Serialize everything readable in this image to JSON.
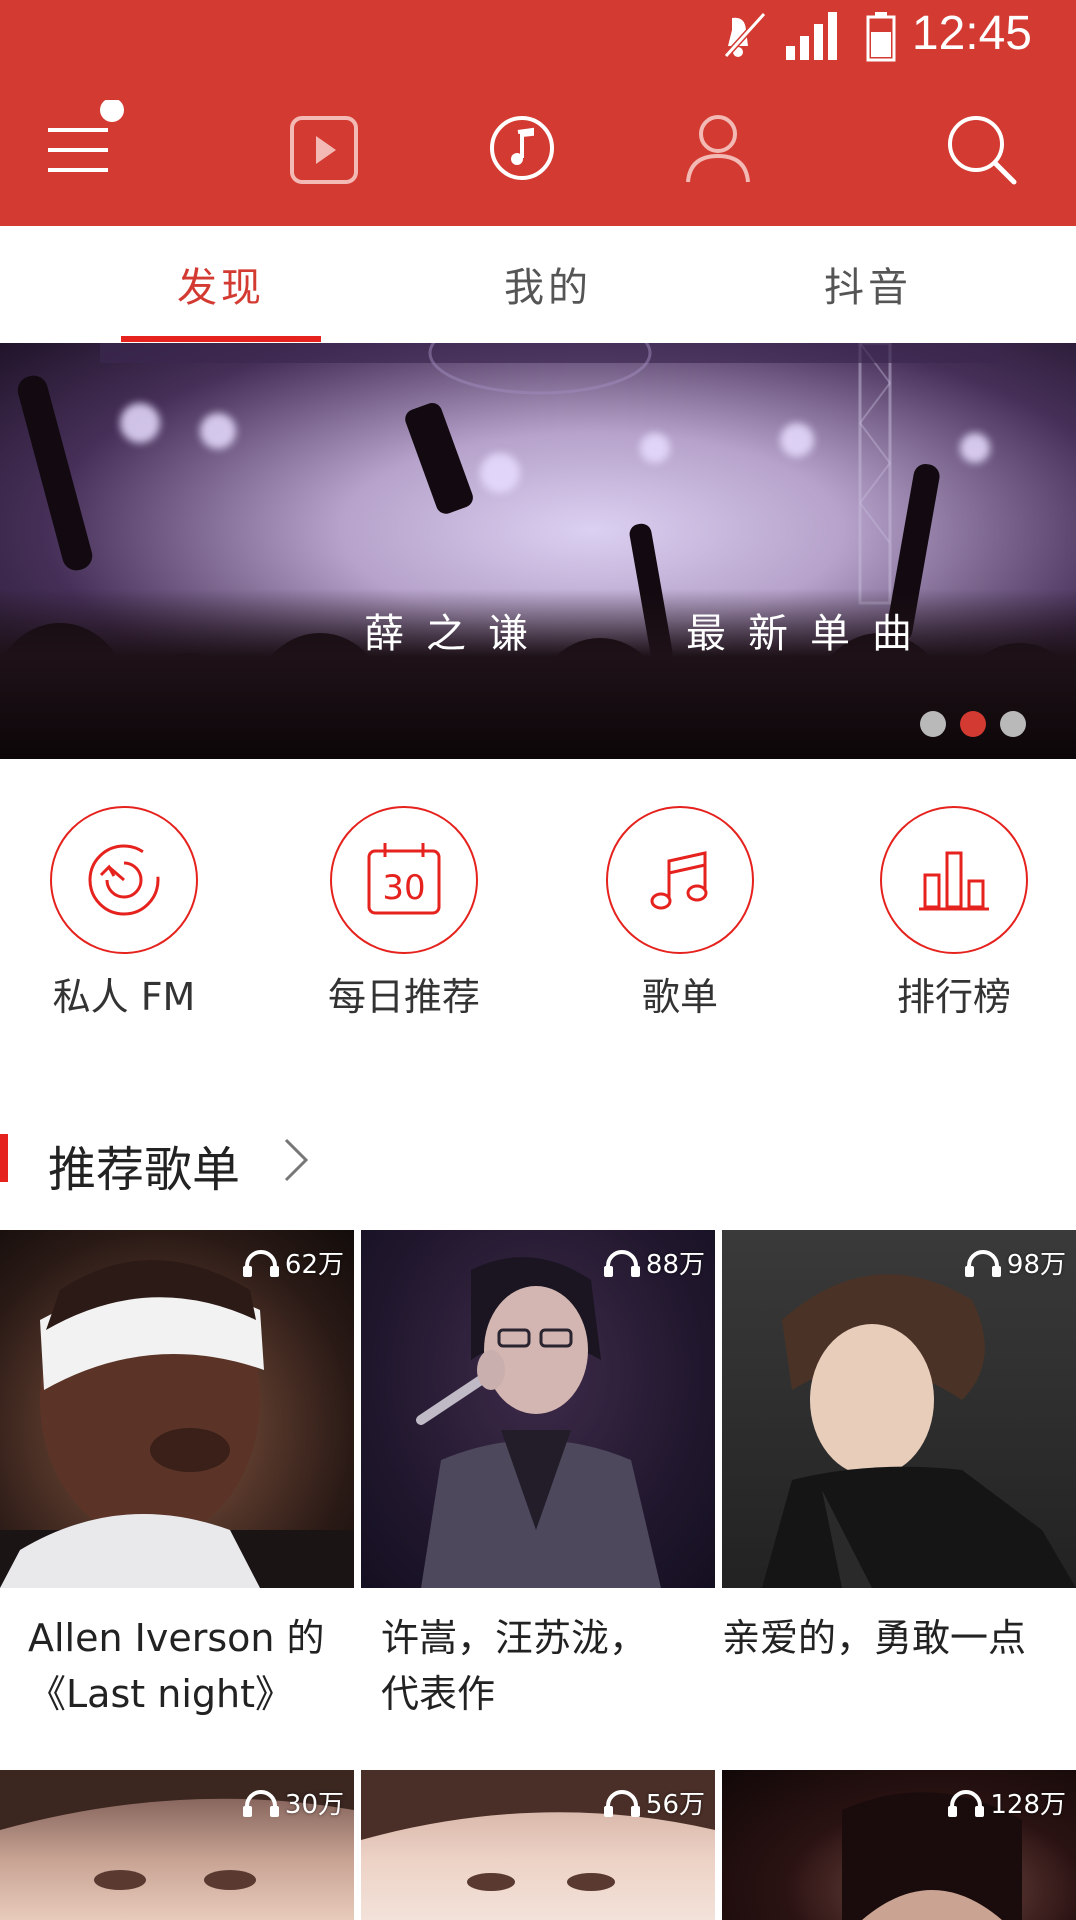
{
  "status": {
    "time": "12:45"
  },
  "tabs": [
    {
      "label": "发现"
    },
    {
      "label": "我的"
    },
    {
      "label": "抖音"
    }
  ],
  "banner": {
    "text_left": "薛之谦",
    "text_right": "最新单曲",
    "dots": 3,
    "active_dot": 1
  },
  "entries": [
    {
      "label": "私人 FM",
      "icon": "radio-dial-icon"
    },
    {
      "label": "每日推荐",
      "icon": "calendar-30-icon"
    },
    {
      "label": "歌单",
      "icon": "music-note-icon"
    },
    {
      "label": "排行榜",
      "icon": "bar-chart-icon"
    }
  ],
  "section": {
    "title": "推荐歌单"
  },
  "playlists": [
    {
      "count": "62万",
      "title_line1": "Allen Iverson 的",
      "title_line2": "《Last night》"
    },
    {
      "count": "88万",
      "title_line1": "许嵩，汪苏泷，",
      "title_line2": "代表作"
    },
    {
      "count": "98万",
      "title_line1": "亲爱的，勇敢一点",
      "title_line2": ""
    },
    {
      "count": "30万",
      "title_line1": "",
      "title_line2": ""
    },
    {
      "count": "56万",
      "title_line1": "",
      "title_line2": ""
    },
    {
      "count": "128万",
      "title_line1": "",
      "title_line2": ""
    }
  ],
  "colors": {
    "brand_red": "#d33a31",
    "accent_red": "#e5221d"
  }
}
